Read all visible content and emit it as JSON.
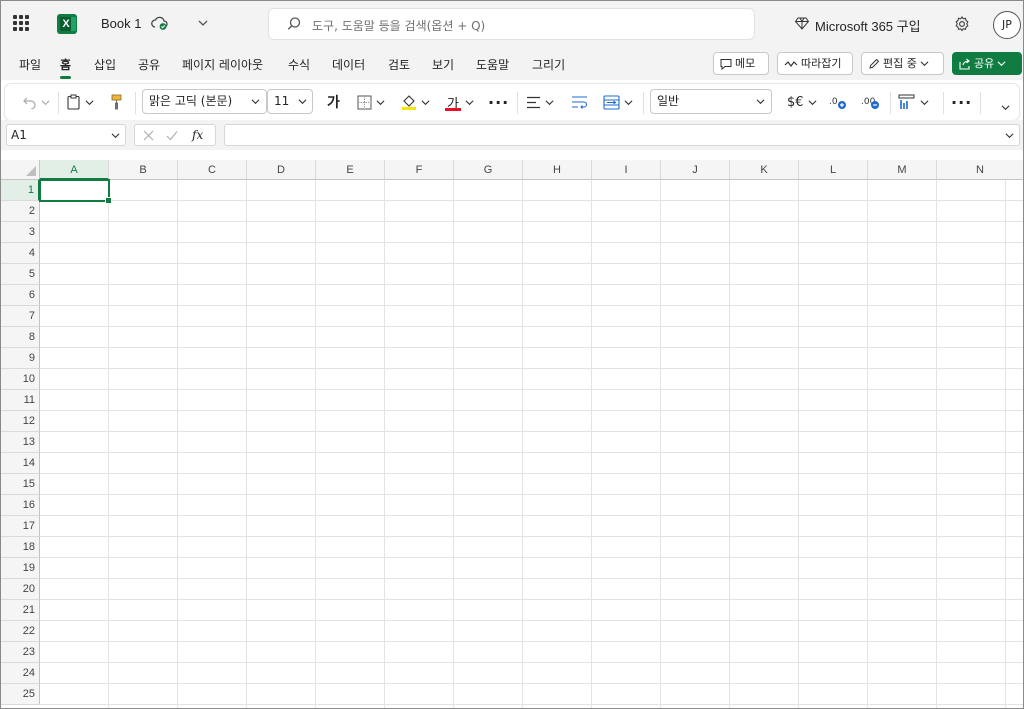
{
  "titlebar": {
    "doc_title": "Book 1",
    "search_placeholder": "도구, 도움말 등을 검색(옵션 + Q)",
    "ms365": "Microsoft 365 구입",
    "avatar": "JP"
  },
  "tabs": [
    "파일",
    "홈",
    "삽입",
    "공유",
    "페이지 레이아웃",
    "수식",
    "데이터",
    "검토",
    "보기",
    "도움말",
    "그리기"
  ],
  "tab_buttons": {
    "memo": "메모",
    "follow": "따라잡기",
    "editing": "편집 중",
    "share": "공유"
  },
  "ribbon": {
    "font_name": "맑은 고딕 (본문)",
    "font_size": "11",
    "bold_glyph": "가",
    "font_color_glyph": "가",
    "number_format": "일반",
    "currency": "$€"
  },
  "formula_bar": {
    "name_box": "A1",
    "fx": "fx",
    "formula": ""
  },
  "columns": [
    "A",
    "B",
    "C",
    "D",
    "E",
    "F",
    "G",
    "H",
    "I",
    "J",
    "K",
    "L",
    "M",
    "N"
  ],
  "rows": [
    "1",
    "2",
    "3",
    "4",
    "5",
    "6",
    "7",
    "8",
    "9",
    "10",
    "11",
    "12",
    "13",
    "14",
    "15",
    "16",
    "17",
    "18",
    "19",
    "20",
    "21",
    "22",
    "23",
    "24",
    "25"
  ],
  "selected_cell": "A1",
  "colors": {
    "accent": "#107c41"
  }
}
